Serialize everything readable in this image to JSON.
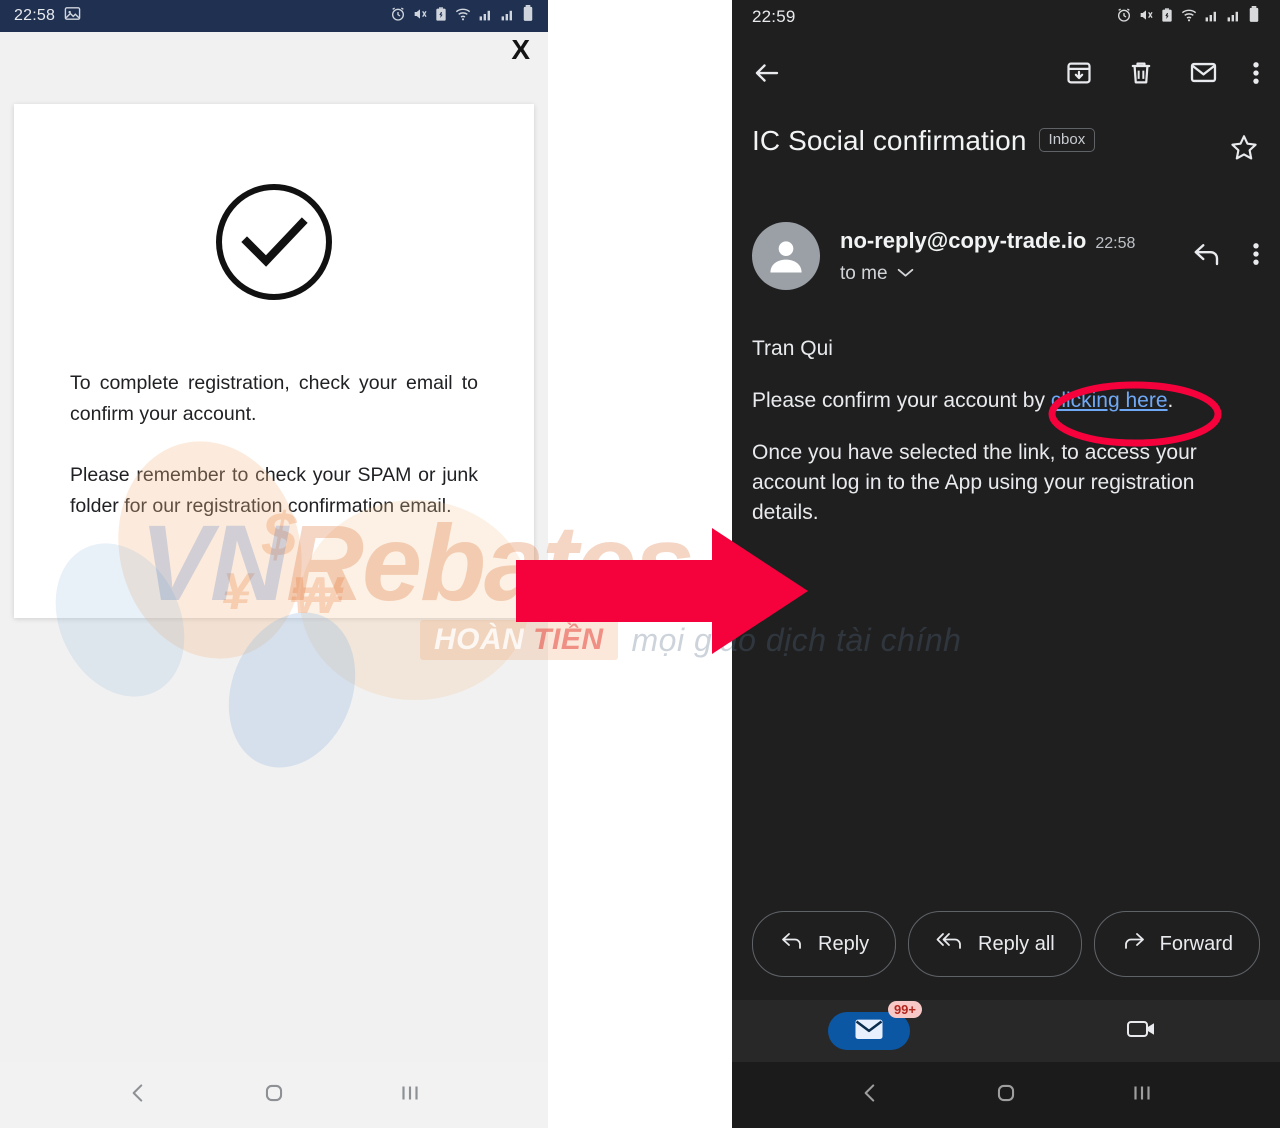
{
  "left_phone": {
    "status_bar": {
      "time": "22:58",
      "icons_left": [
        "image-icon"
      ],
      "icons_right": [
        "alarm-icon",
        "vibrate-mute-icon",
        "battery-saver-icon",
        "wifi-icon",
        "signal-1-icon",
        "signal-2-icon",
        "battery-icon"
      ],
      "background_color": "#1f3050"
    },
    "close_label": "X",
    "dialog": {
      "icon": "check-circle-icon",
      "paragraphs": [
        "To complete registration, check your email to confirm your account.",
        "Please remember to check your SPAM or junk folder for our registration confirmation email."
      ]
    },
    "nav_bar": {
      "back": "back-icon",
      "home": "home-icon",
      "recents": "recents-icon"
    }
  },
  "right_phone": {
    "status_bar": {
      "time": "22:59",
      "icons_right": [
        "alarm-icon",
        "vibrate-mute-icon",
        "battery-saver-icon",
        "wifi-icon",
        "signal-1-icon",
        "signal-2-icon",
        "battery-icon"
      ],
      "background_color": "#1f1f1f"
    },
    "app_bar": {
      "back": "back-arrow-icon",
      "archive": "archive-icon",
      "delete": "trash-icon",
      "mark_unread": "envelope-icon",
      "more": "more-vert-icon"
    },
    "subject": "IC Social confirmation",
    "label_chip": "Inbox",
    "star": "star-outline-icon",
    "sender": {
      "avatar": "person-avatar-icon",
      "email": "no-reply@copy-trade.io",
      "time": "22:58",
      "recipient": "to me",
      "recipient_chevron": "chevron-down-icon",
      "reply_icon": "reply-arrow-icon",
      "more_icon": "more-vert-icon"
    },
    "body": {
      "greeting": "Tran Qui",
      "line2_before": "Please confirm your account by ",
      "line2_link": "clicking here",
      "line2_after": ".",
      "line3": "Once you have selected the link, to access your account log in to the App using your registration details."
    },
    "actions": [
      {
        "label": "Reply",
        "icon": "reply-icon"
      },
      {
        "label": "Reply all",
        "icon": "reply-all-icon"
      },
      {
        "label": "Forward",
        "icon": "forward-icon"
      }
    ],
    "bottom_nav": {
      "mail_icon": "mail-icon",
      "mail_badge": "99+",
      "meet_icon": "video-camera-icon",
      "active_color": "#0b57a4"
    },
    "nav_bar": {
      "back": "back-icon",
      "home": "home-icon",
      "recents": "recents-icon"
    }
  },
  "annotations": {
    "arrow": {
      "name": "red-arrow",
      "color": "#f5013c"
    },
    "ellipse": {
      "name": "red-ellipse-highlight",
      "color": "#f5013c"
    }
  },
  "watermark": {
    "brand_vn": "VN",
    "brand_rebates": "Rebates",
    "chip_hoan": "HOÀN ",
    "chip_tien": "TIỀN",
    "tagline": "mọi giao dịch tài chính",
    "currency_symbols": [
      "$",
      "¥",
      "₩"
    ]
  }
}
